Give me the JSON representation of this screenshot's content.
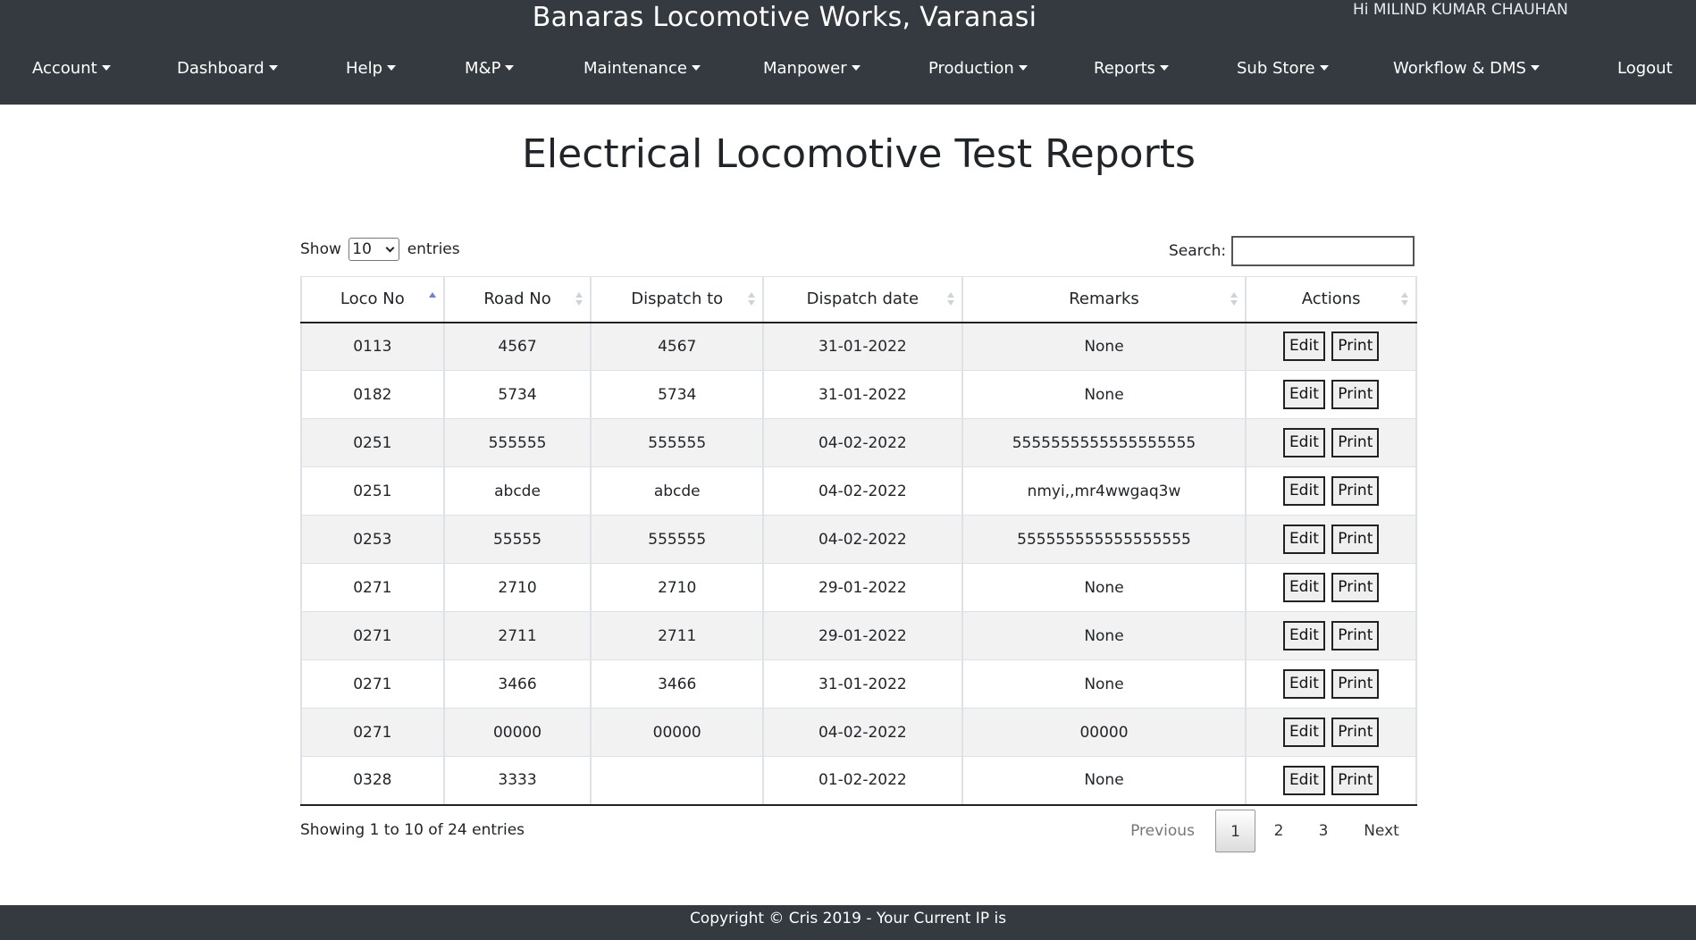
{
  "header": {
    "site_title": "Banaras Locomotive Works, Varanasi",
    "greeting": "Hi MILIND KUMAR CHAUHAN"
  },
  "nav": {
    "items": [
      {
        "label": "Account",
        "dropdown": true
      },
      {
        "label": "Dashboard",
        "dropdown": true
      },
      {
        "label": "Help",
        "dropdown": true
      },
      {
        "label": "M&P",
        "dropdown": true
      },
      {
        "label": "Maintenance",
        "dropdown": true
      },
      {
        "label": "Manpower",
        "dropdown": true
      },
      {
        "label": "Production",
        "dropdown": true
      },
      {
        "label": "Reports",
        "dropdown": true
      },
      {
        "label": "Sub Store",
        "dropdown": true
      },
      {
        "label": "Workflow & DMS",
        "dropdown": true
      },
      {
        "label": "Logout",
        "dropdown": false
      }
    ]
  },
  "page": {
    "title": "Electrical Locomotive Test Reports"
  },
  "table_controls": {
    "show_label": "Show",
    "entries_label": "entries",
    "page_length": "10",
    "search_label": "Search:",
    "search_value": ""
  },
  "table": {
    "columns": [
      "Loco No",
      "Road No",
      "Dispatch to",
      "Dispatch date",
      "Remarks",
      "Actions"
    ],
    "sorted_column": "Loco No",
    "sort_direction": "ascending",
    "edit_label": "Edit",
    "print_label": "Print",
    "rows": [
      [
        "0113",
        "4567",
        "4567",
        "31-01-2022",
        "None"
      ],
      [
        "0182",
        "5734",
        "5734",
        "31-01-2022",
        "None"
      ],
      [
        "0251",
        "555555",
        "555555",
        "04-02-2022",
        "5555555555555555555"
      ],
      [
        "0251",
        "abcde",
        "abcde",
        "04-02-2022",
        "nmyi,,mr4wwgaq3w"
      ],
      [
        "0253",
        "55555",
        "555555",
        "04-02-2022",
        "555555555555555555"
      ],
      [
        "0271",
        "2710",
        "2710",
        "29-01-2022",
        "None"
      ],
      [
        "0271",
        "2711",
        "2711",
        "29-01-2022",
        "None"
      ],
      [
        "0271",
        "3466",
        "3466",
        "31-01-2022",
        "None"
      ],
      [
        "0271",
        "00000",
        "00000",
        "04-02-2022",
        "00000"
      ],
      [
        "0328",
        "3333",
        "",
        "01-02-2022",
        "None"
      ]
    ]
  },
  "pagination": {
    "info": "Showing 1 to 10 of 24 entries",
    "previous": "Previous",
    "pages": [
      "1",
      "2",
      "3"
    ],
    "current_page": "1",
    "next": "Next"
  },
  "footer": {
    "text": "Copyright © Cris 2019 - Your Current IP is"
  },
  "colors": {
    "header_bg": "#343a40",
    "footer_bg": "#343a40",
    "striped_row": "#f2f2f2",
    "sort_active": "#6f7fd6"
  }
}
